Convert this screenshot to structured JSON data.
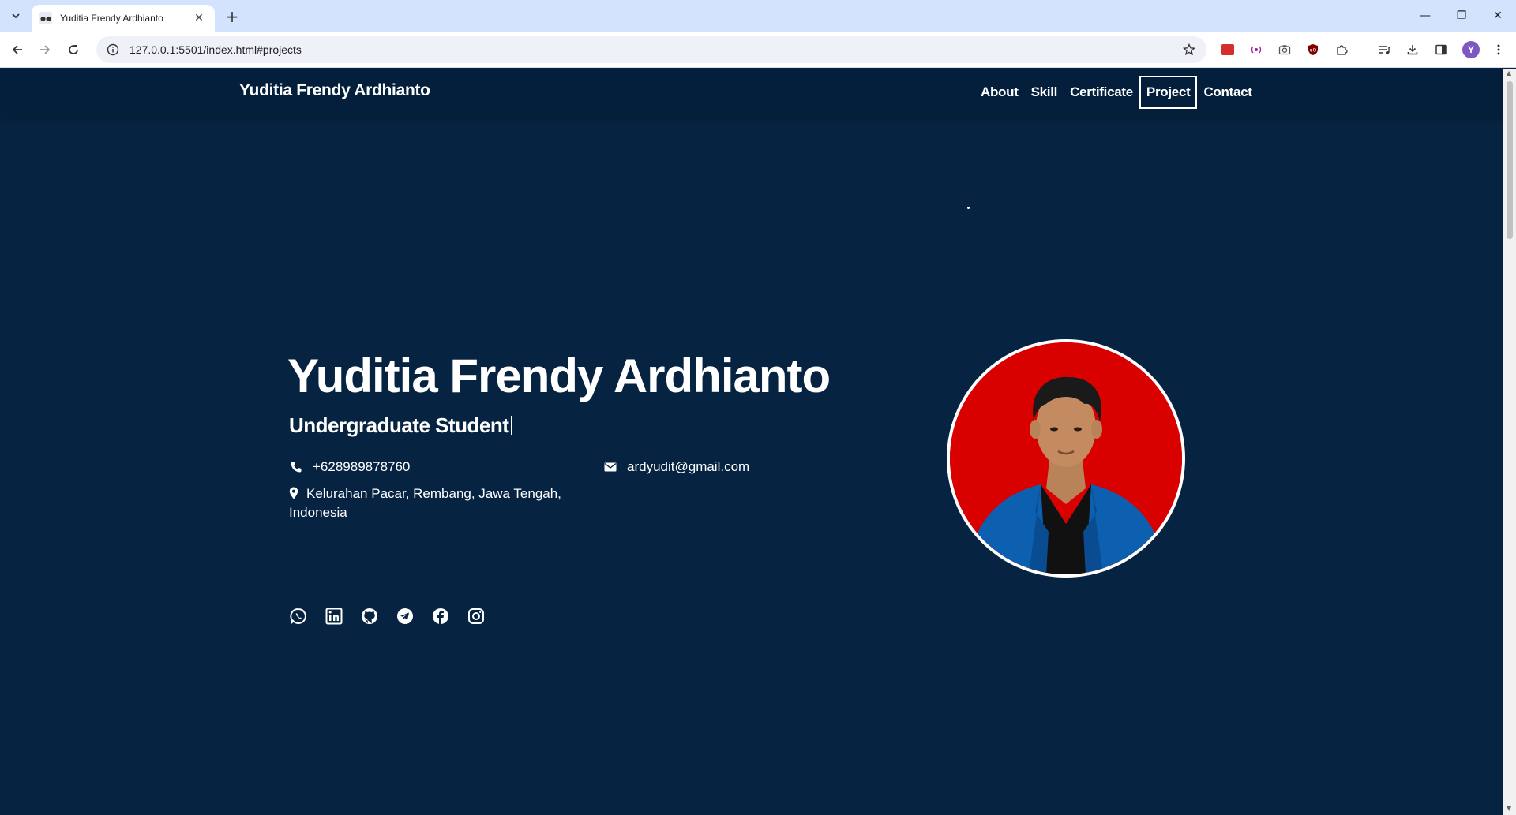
{
  "browser": {
    "tab_title": "Yuditia Frendy Ardhianto",
    "url": "127.0.0.1:5501/index.html#projects",
    "avatar_letter": "Y"
  },
  "site": {
    "brand": "Yuditia Frendy Ardhianto",
    "nav": [
      {
        "label": "About"
      },
      {
        "label": "Skill"
      },
      {
        "label": "Certificate"
      },
      {
        "label": "Project",
        "active": true
      },
      {
        "label": "Contact"
      }
    ]
  },
  "hero": {
    "name": "Yuditia Frendy Ardhianto",
    "role": "Undergraduate Student",
    "phone": "+628989878760",
    "email": "ardyudit@gmail.com",
    "address": "Kelurahan Pacar, Rembang, Jawa Tengah, Indonesia",
    "socials": [
      "whatsapp-icon",
      "linkedin-icon",
      "github-icon",
      "telegram-icon",
      "facebook-icon",
      "instagram-icon"
    ]
  },
  "colors": {
    "page_bg": "#062342",
    "navbar_bg": "#041f3c",
    "photo_bg": "#d90000",
    "jacket": "#0d5fb0"
  }
}
